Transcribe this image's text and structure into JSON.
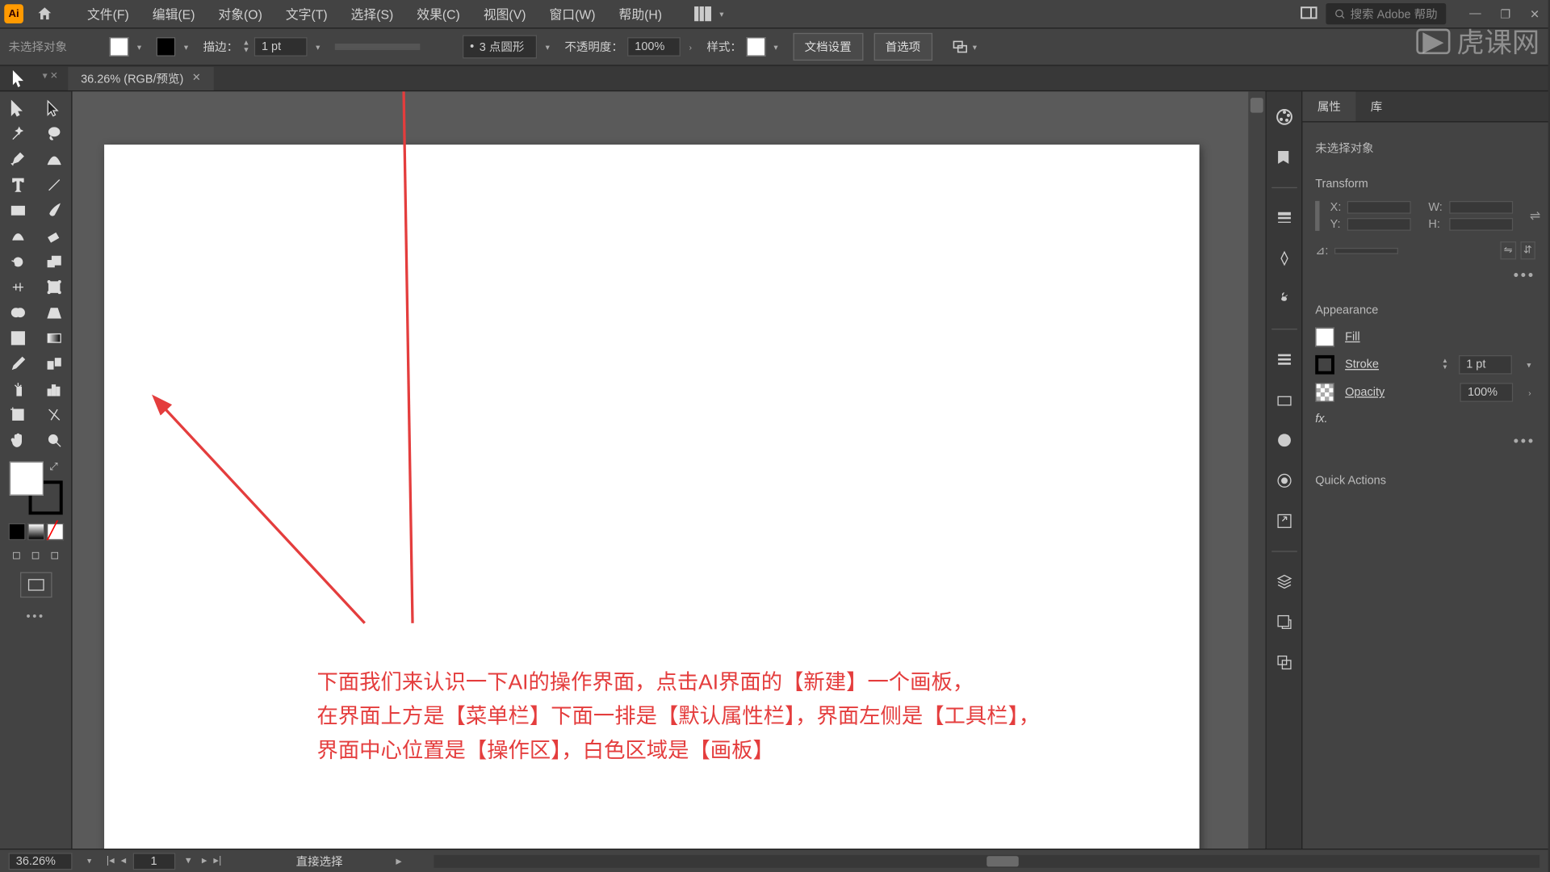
{
  "menubar": {
    "file": "文件(F)",
    "edit": "编辑(E)",
    "object": "对象(O)",
    "type": "文字(T)",
    "select": "选择(S)",
    "effect": "效果(C)",
    "view": "视图(V)",
    "window": "窗口(W)",
    "help": "帮助(H)"
  },
  "search_placeholder": "搜索 Adobe 帮助",
  "options": {
    "noselect": "未选择对象",
    "stroke_label": "描边：",
    "stroke_weight": "1 pt",
    "dash_preset": "3 点圆形",
    "opacity_label": "不透明度：",
    "opacity_value": "100%",
    "style_label": "样式：",
    "doc_setup": "文档设置",
    "prefs": "首选项"
  },
  "doc_tab": "36.26% (RGB/预览)",
  "annotation": {
    "line1": "下面我们来认识一下AI的操作界面，点击AI界面的【新建】一个画板，",
    "line2": "在界面上方是【菜单栏】下面一排是【默认属性栏】，界面左侧是【工具栏】，",
    "line3": "界面中心位置是【操作区】，白色区域是【画板】"
  },
  "props": {
    "tab_props": "属性",
    "tab_lib": "库",
    "noselect": "未选择对象",
    "transform": "Transform",
    "x_label": "X:",
    "y_label": "Y:",
    "w_label": "W:",
    "h_label": "H:",
    "appearance": "Appearance",
    "fill": "Fill",
    "stroke": "Stroke",
    "stroke_val": "1 pt",
    "opacity": "Opacity",
    "opacity_val": "100%",
    "fx": "fx.",
    "quick_actions": "Quick Actions"
  },
  "status": {
    "zoom": "36.26%",
    "artboard": "1",
    "tool": "直接选择"
  },
  "watermark": "虎课网"
}
